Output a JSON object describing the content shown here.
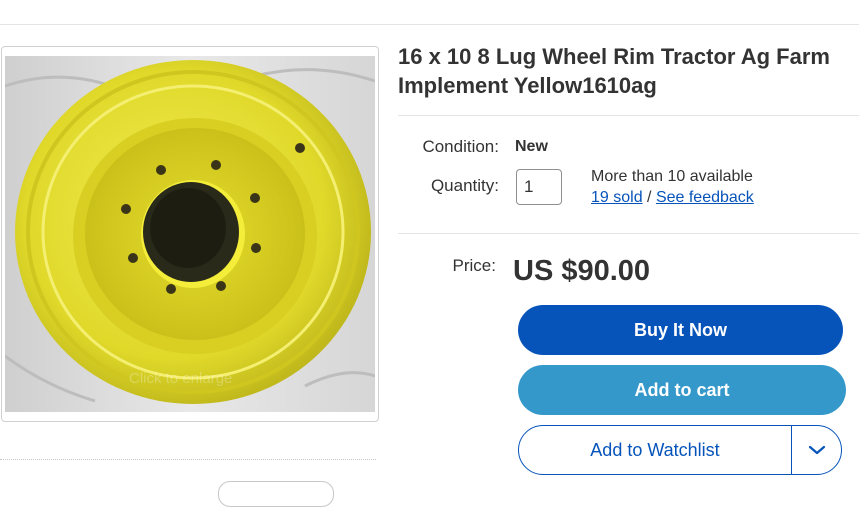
{
  "listing": {
    "title": "16 x 10 8 Lug Wheel Rim Tractor Ag Farm Implement Yellow1610ag",
    "image_overlay_text": "Click to enlarge"
  },
  "condition": {
    "label": "Condition:",
    "value": "New"
  },
  "quantity": {
    "label": "Quantity:",
    "value": "1",
    "available_text": "More than 10 available",
    "sold_link": "19 sold",
    "separator": " / ",
    "feedback_link": "See feedback"
  },
  "price": {
    "label": "Price:",
    "value": "US $90.00"
  },
  "actions": {
    "buy_now": "Buy It Now",
    "add_to_cart": "Add to cart",
    "add_to_watchlist": "Add to Watchlist",
    "watchlist_dropdown_icon": "chevron-down-icon"
  },
  "colors": {
    "primary_blue": "#0654ba",
    "cart_blue": "#3498ca",
    "rim_yellow": "#e6e02a",
    "text": "#333333"
  }
}
